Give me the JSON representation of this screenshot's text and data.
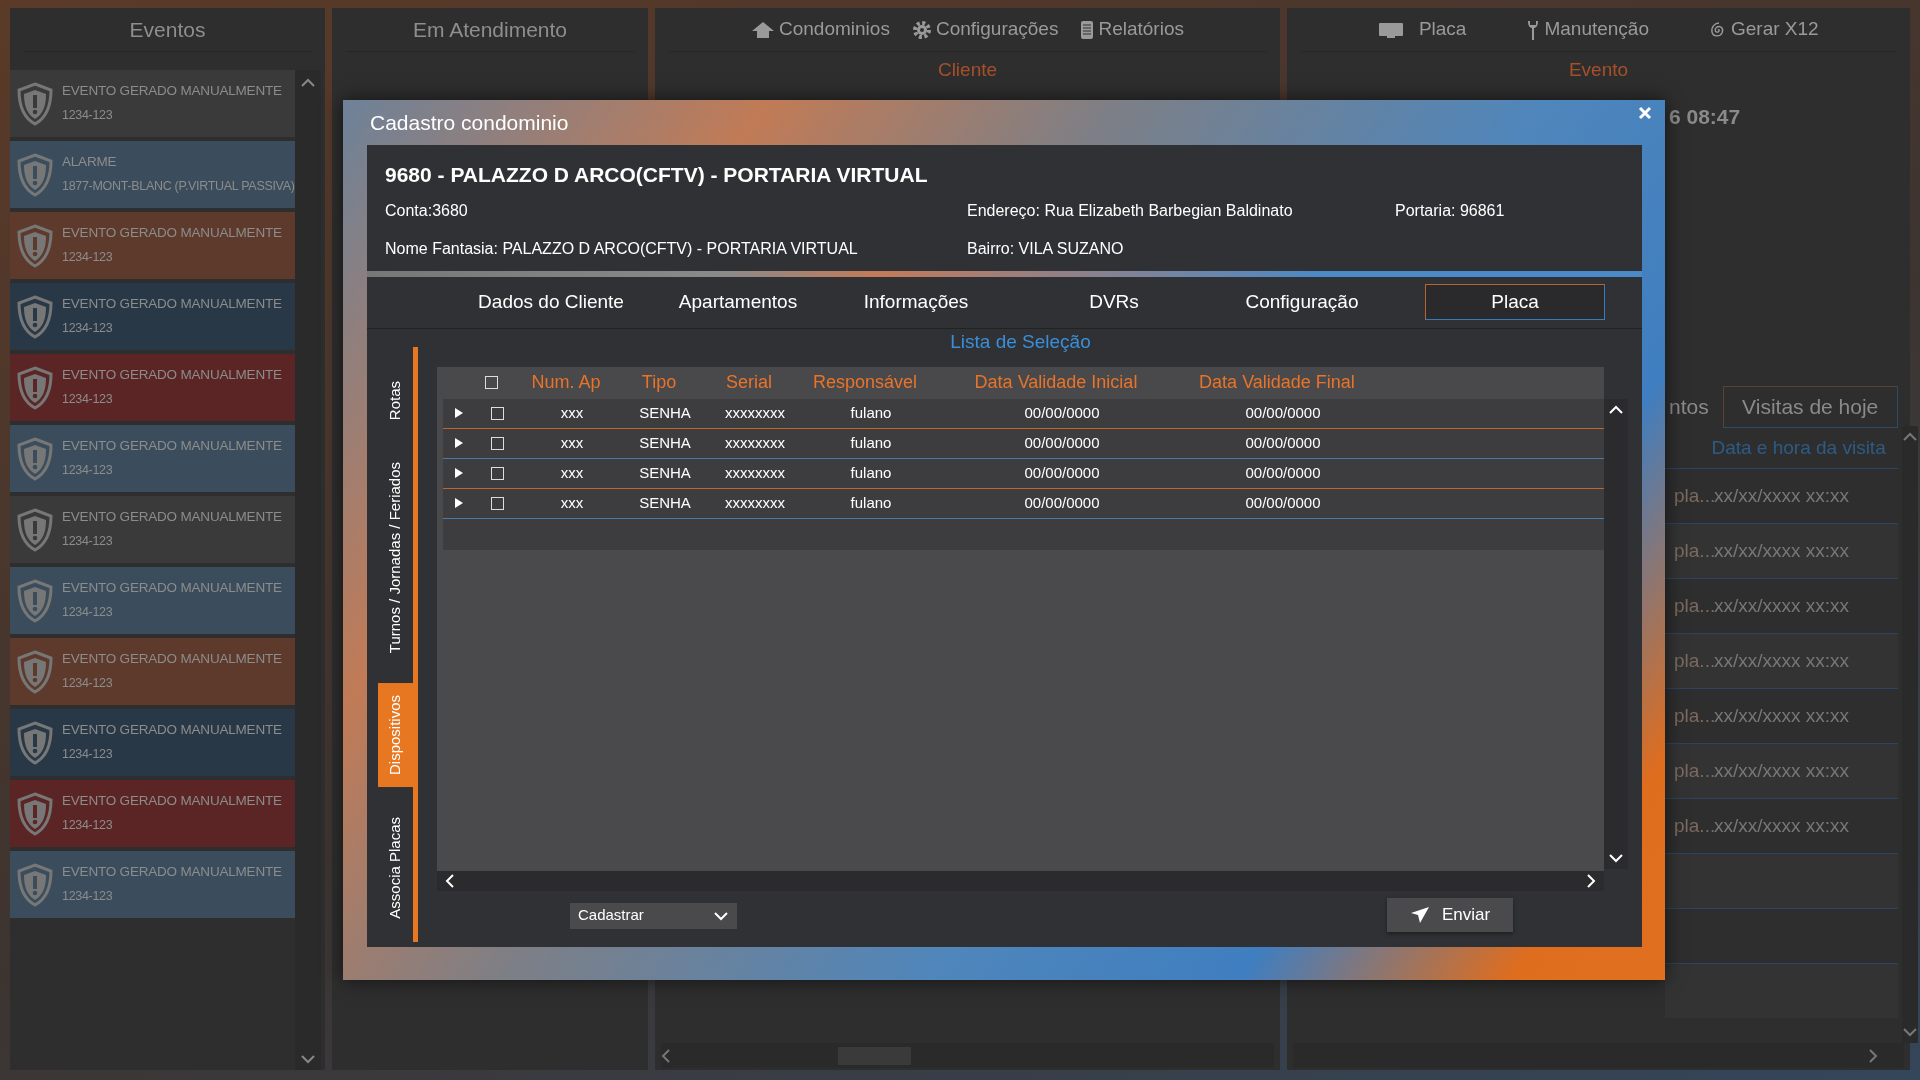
{
  "events_panel": {
    "title": "Eventos",
    "items": [
      {
        "title": "EVENTO GERADO MANUALMENTE",
        "code": "1234-123",
        "color": "#3a3a3a"
      },
      {
        "title": "ALARME",
        "code": "1877-MONT-BLANC (P.VIRTUAL PASSIVA)",
        "color": "#3b4d5c"
      },
      {
        "title": "EVENTO GERADO MANUALMENTE",
        "code": "1234-123",
        "color": "#5e3a2d"
      },
      {
        "title": "EVENTO GERADO MANUALMENTE",
        "code": "1234-123",
        "color": "#283847"
      },
      {
        "title": "EVENTO GERADO MANUALMENTE",
        "code": "1234-123",
        "color": "#5c2525"
      },
      {
        "title": "EVENTO GERADO MANUALMENTE",
        "code": "1234-123",
        "color": "#3b4d5c"
      },
      {
        "title": "EVENTO GERADO MANUALMENTE",
        "code": "1234-123",
        "color": "#3a3a3a"
      },
      {
        "title": "EVENTO GERADO MANUALMENTE",
        "code": "1234-123",
        "color": "#3b4d5c"
      },
      {
        "title": "EVENTO GERADO MANUALMENTE",
        "code": "1234-123",
        "color": "#5e3a2d"
      },
      {
        "title": "EVENTO GERADO MANUALMENTE",
        "code": "1234-123",
        "color": "#283847"
      },
      {
        "title": "EVENTO GERADO MANUALMENTE",
        "code": "1234-123",
        "color": "#5c2525"
      },
      {
        "title": "EVENTO GERADO MANUALMENTE",
        "code": "1234-123",
        "color": "#3b4d5c"
      }
    ]
  },
  "attendance_panel": {
    "title": "Em Atendimento"
  },
  "client_panel": {
    "menu": [
      "Condominios",
      "Configurações",
      "Relatórios"
    ],
    "heading": "Cliente"
  },
  "event_panel": {
    "menu": [
      "Placa",
      "Manutenção",
      "Gerar X12"
    ],
    "heading": "Evento",
    "call_text": "6 08:47",
    "visit_tabs": [
      {
        "label": "ntos",
        "selected": false
      },
      {
        "label": "Visitas de hoje",
        "selected": true
      }
    ],
    "visit_header": "Data e hora da visita",
    "visits": [
      {
        "column_1": "pla...",
        "date": "xx/xx/xxxx xx:xx"
      },
      {
        "column_1": "pla...",
        "date": "xx/xx/xxxx xx:xx"
      },
      {
        "column_1": "pla...",
        "date": "xx/xx/xxxx xx:xx"
      },
      {
        "column_1": "pla...",
        "date": "xx/xx/xxxx xx:xx"
      },
      {
        "column_1": "pla...",
        "date": "xx/xx/xxxx xx:xx"
      },
      {
        "column_1": "pla...",
        "date": "xx/xx/xxxx xx:xx"
      },
      {
        "column_1": "pla...",
        "date": "xx/xx/xxxx xx:xx"
      }
    ]
  },
  "modal": {
    "title": "Cadastro condominio",
    "client": {
      "name": "9680 - PALAZZO D ARCO(CFTV) - PORTARIA VIRTUAL",
      "account": "Conta:3680",
      "address": "Endereço: Rua Elizabeth Barbegian Baldinato",
      "portaria": "Portaria: 96861",
      "fantasy_name": "Nome Fantasia: PALAZZO D ARCO(CFTV) - PORTARIA VIRTUAL",
      "district": "Bairro: VILA SUZANO"
    },
    "tabs": [
      {
        "label": "Dados do Cliente",
        "selected": false
      },
      {
        "label": "Apartamentos",
        "selected": false
      },
      {
        "label": "Informações",
        "selected": false
      },
      {
        "label": "DVRs",
        "selected": false
      },
      {
        "label": "Configuração",
        "selected": false
      },
      {
        "label": "Placa",
        "selected": true
      }
    ],
    "side_tabs": [
      {
        "label": "Rotas",
        "selected": false
      },
      {
        "label": "Turnos / Jornadas / Feriados",
        "selected": false
      },
      {
        "label": "Dispositivos",
        "selected": true
      },
      {
        "label": "Associa Placas",
        "selected": false
      }
    ],
    "list_title": "Lista de Seleção",
    "table": {
      "header_checked": false,
      "columns": [
        "Num. Ap",
        "Tipo",
        "Serial",
        "Responsável",
        "Data Validade Inicial",
        "Data Validade Final"
      ],
      "rows": [
        {
          "checked": false,
          "cells": [
            "xxx",
            "SENHA",
            "xxxxxxxx",
            "fulano",
            "00/00/0000",
            "00/00/0000"
          ]
        },
        {
          "checked": false,
          "cells": [
            "xxx",
            "SENHA",
            "xxxxxxxx",
            "fulano",
            "00/00/0000",
            "00/00/0000"
          ]
        },
        {
          "checked": false,
          "cells": [
            "xxx",
            "SENHA",
            "xxxxxxxx",
            "fulano",
            "00/00/0000",
            "00/00/0000"
          ]
        },
        {
          "checked": false,
          "cells": [
            "xxx",
            "SENHA",
            "xxxxxxxx",
            "fulano",
            "00/00/0000",
            "00/00/0000"
          ]
        }
      ]
    },
    "action_select": {
      "value": "Cadastrar"
    },
    "send_button": "Enviar"
  }
}
